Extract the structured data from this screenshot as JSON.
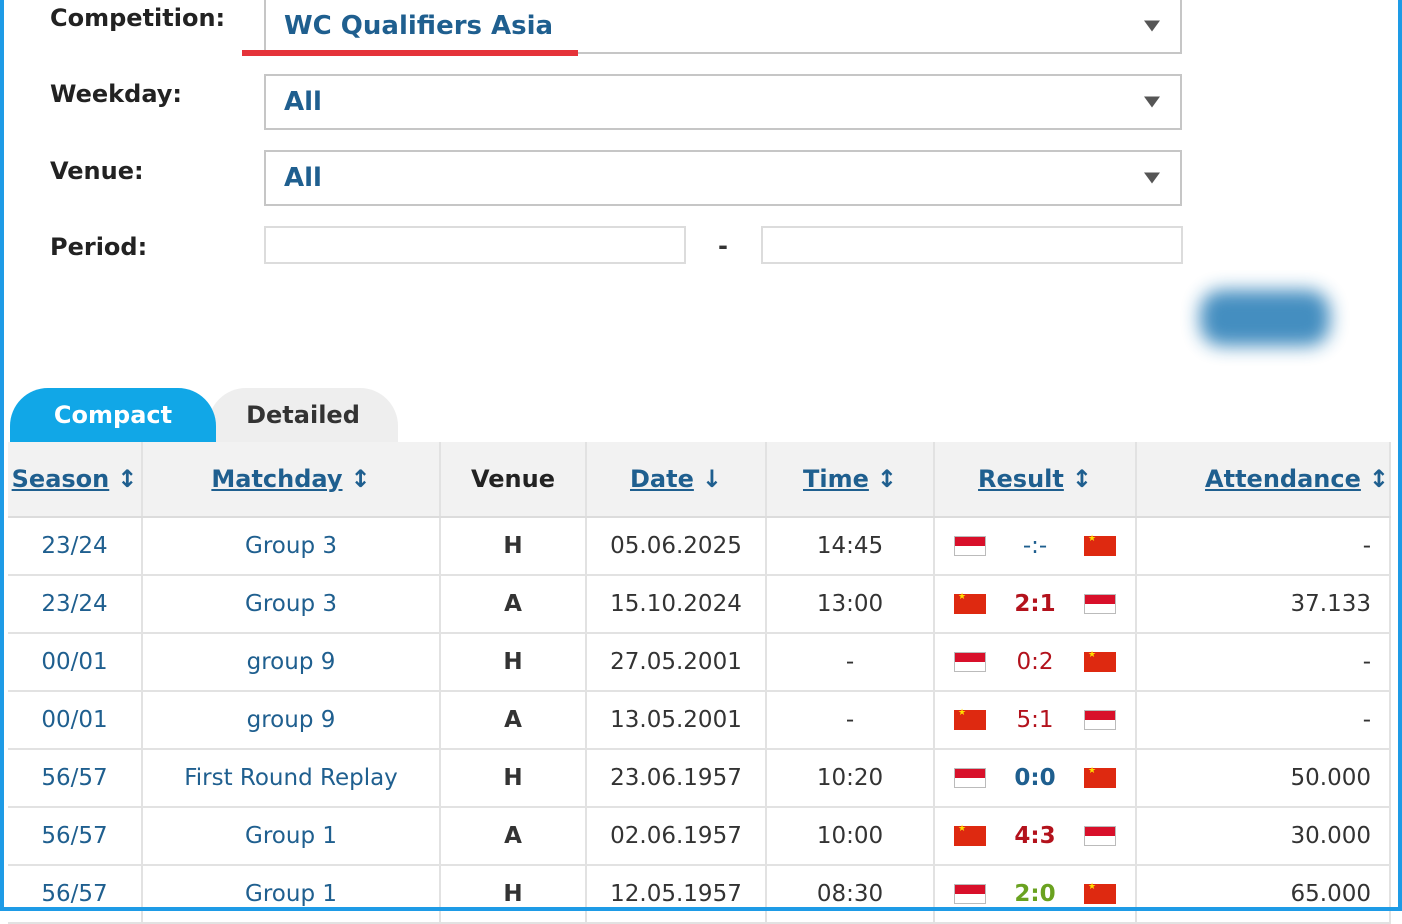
{
  "filters": {
    "competition_label": "Competition:",
    "competition_value": "WC Qualifiers Asia",
    "weekday_label": "Weekday:",
    "weekday_value": "All",
    "venue_label": "Venue:",
    "venue_value": "All",
    "period_label": "Period:",
    "period_from": "",
    "period_to": "",
    "period_separator": "-"
  },
  "tabs": [
    {
      "label": "Compact",
      "active": true
    },
    {
      "label": "Detailed",
      "active": false
    }
  ],
  "table": {
    "headers": {
      "season": "Season",
      "matchday": "Matchday",
      "venue": "Venue",
      "date": "Date",
      "time": "Time",
      "result": "Result",
      "attendance": "Attendance"
    },
    "rows": [
      {
        "season": "23/24",
        "matchday": "Group 3",
        "venue": "H",
        "date": "05.06.2025",
        "time": "14:45",
        "home_flag": "indonesia-flag",
        "score": "-:-",
        "away_flag": "china-flag",
        "attendance": "-",
        "score_color": "#1f5f8f",
        "score_bold": false
      },
      {
        "season": "23/24",
        "matchday": "Group 3",
        "venue": "A",
        "date": "15.10.2024",
        "time": "13:00",
        "home_flag": "china-flag",
        "score": "2:1",
        "away_flag": "indonesia-flag",
        "attendance": "37.133",
        "score_color": "#b3121c",
        "score_bold": true
      },
      {
        "season": "00/01",
        "matchday": "group 9",
        "venue": "H",
        "date": "27.05.2001",
        "time": "-",
        "home_flag": "indonesia-flag",
        "score": "0:2",
        "away_flag": "china-flag",
        "attendance": "-",
        "score_color": "#b3121c",
        "score_bold": false
      },
      {
        "season": "00/01",
        "matchday": "group 9",
        "venue": "A",
        "date": "13.05.2001",
        "time": "-",
        "home_flag": "china-flag",
        "score": "5:1",
        "away_flag": "indonesia-flag",
        "attendance": "-",
        "score_color": "#b3121c",
        "score_bold": false
      },
      {
        "season": "56/57",
        "matchday": "First Round Replay",
        "venue": "H",
        "date": "23.06.1957",
        "time": "10:20",
        "home_flag": "indonesia-flag",
        "score": "0:0",
        "away_flag": "china-flag",
        "attendance": "50.000",
        "score_color": "#1f5f8f",
        "score_bold": true
      },
      {
        "season": "56/57",
        "matchday": "Group 1",
        "venue": "A",
        "date": "02.06.1957",
        "time": "10:00",
        "home_flag": "china-flag",
        "score": "4:3",
        "away_flag": "indonesia-flag",
        "attendance": "30.000",
        "score_color": "#b3121c",
        "score_bold": true
      },
      {
        "season": "56/57",
        "matchday": "Group 1",
        "venue": "H",
        "date": "12.05.1957",
        "time": "08:30",
        "home_flag": "indonesia-flag",
        "score": "2:0",
        "away_flag": "china-flag",
        "attendance": "65.000",
        "score_color": "#6aa220",
        "score_bold": true
      }
    ]
  },
  "colors": {
    "accent": "#11a7e7",
    "link": "#1f5f8f",
    "loss": "#b3121c",
    "win": "#6aa220",
    "highlight_underline": "#e5333a"
  }
}
